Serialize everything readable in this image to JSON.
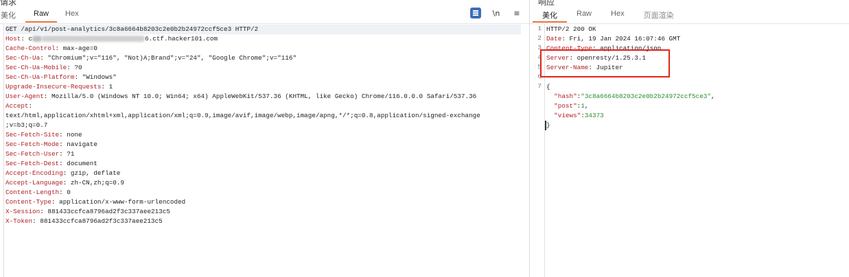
{
  "request": {
    "title": "请求",
    "tabs": [
      {
        "label": "美化",
        "active": false
      },
      {
        "label": "Raw",
        "active": true
      },
      {
        "label": "Hex",
        "active": false
      }
    ],
    "toolbar": {
      "newline_label": "\\n",
      "menu_label": "≡"
    },
    "lines": [
      {
        "raw": "GET /api/v1/post-analytics/3c8a6664b8203c2e0b2b24972ccf5ce3 HTTP/2"
      },
      {
        "key": "Host",
        "pre": "c",
        "post": "6.ctf.hacker101.com"
      },
      {
        "key": "Cache-Control",
        "value": "max-age=0"
      },
      {
        "key": "Sec-Ch-Ua",
        "value": "\"Chromium\";v=\"116\", \"Not)A;Brand\";v=\"24\", \"Google Chrome\";v=\"116\""
      },
      {
        "key": "Sec-Ch-Ua-Mobile",
        "value": "?0"
      },
      {
        "key": "Sec-Ch-Ua-Platform",
        "value": "\"Windows\""
      },
      {
        "key": "Upgrade-Insecure-Requests",
        "value": "1"
      },
      {
        "key": "User-Agent",
        "value": "Mozilla/5.0 (Windows NT 10.0; Win64; x64) AppleWebKit/537.36 (KHTML, like Gecko) Chrome/116.0.0.0 Safari/537.36"
      },
      {
        "key": "Accept",
        "value": ""
      },
      {
        "raw": "text/html,application/xhtml+xml,application/xml;q=0.9,image/avif,image/webp,image/apng,*/*;q=0.8,application/signed-exchange"
      },
      {
        "raw": ";v=b3;q=0.7"
      },
      {
        "key": "Sec-Fetch-Site",
        "value": "none"
      },
      {
        "key": "Sec-Fetch-Mode",
        "value": "navigate"
      },
      {
        "key": "Sec-Fetch-User",
        "value": "?1"
      },
      {
        "key": "Sec-Fetch-Dest",
        "value": "document"
      },
      {
        "key": "Accept-Encoding",
        "value": "gzip, deflate"
      },
      {
        "key": "Accept-Language",
        "value": "zh-CN,zh;q=0.9"
      },
      {
        "key": "Content-Length",
        "value": "0"
      },
      {
        "key": "Content-Type",
        "value": "application/x-www-form-urlencoded"
      },
      {
        "key": "X-Session",
        "value": "881433ccfca8796ad2f3c337aee213c5"
      },
      {
        "key": "X-Token",
        "value": "881433ccfca8796ad2f3c337aee213c5"
      }
    ]
  },
  "response": {
    "title": "响应",
    "tabs": [
      {
        "label": "美化",
        "active": true
      },
      {
        "label": "Raw",
        "active": false
      },
      {
        "label": "Hex",
        "active": false
      },
      {
        "label": "页面渲染",
        "active": false
      }
    ],
    "lines": [
      {
        "num": "1",
        "raw": "HTTP/2 200 OK"
      },
      {
        "num": "2",
        "key": "Date",
        "value": "Fri, 19 Jan 2024 16:07:46 GMT"
      },
      {
        "num": "3",
        "key": "Content-Type",
        "value": "application/json"
      },
      {
        "num": "4",
        "key": "Server",
        "value": "openresty/1.25.3.1"
      },
      {
        "num": "5",
        "key": "Server-Name",
        "value": "Jupiter"
      },
      {
        "num": "6",
        "raw": ""
      },
      {
        "num": "7",
        "raw": "{"
      },
      {
        "num": "",
        "json_key": "\"hash\"",
        "json_val": "\"3c8a6664b8203c2e0b2b24972ccf5ce3\"",
        "comma": ","
      },
      {
        "num": "",
        "json_key": "\"post\"",
        "json_val": "1",
        "comma": ","
      },
      {
        "num": "",
        "json_key": "\"views\"",
        "json_val": "34373",
        "comma": ""
      },
      {
        "num": "",
        "raw": "}"
      }
    ]
  },
  "colors": {
    "accent_tab": "#e8743b",
    "header_key": "#b01f24",
    "json_value": "#2a8a2a",
    "highlight_box": "#e0241b",
    "pretty_button": "#3b6fb6"
  }
}
